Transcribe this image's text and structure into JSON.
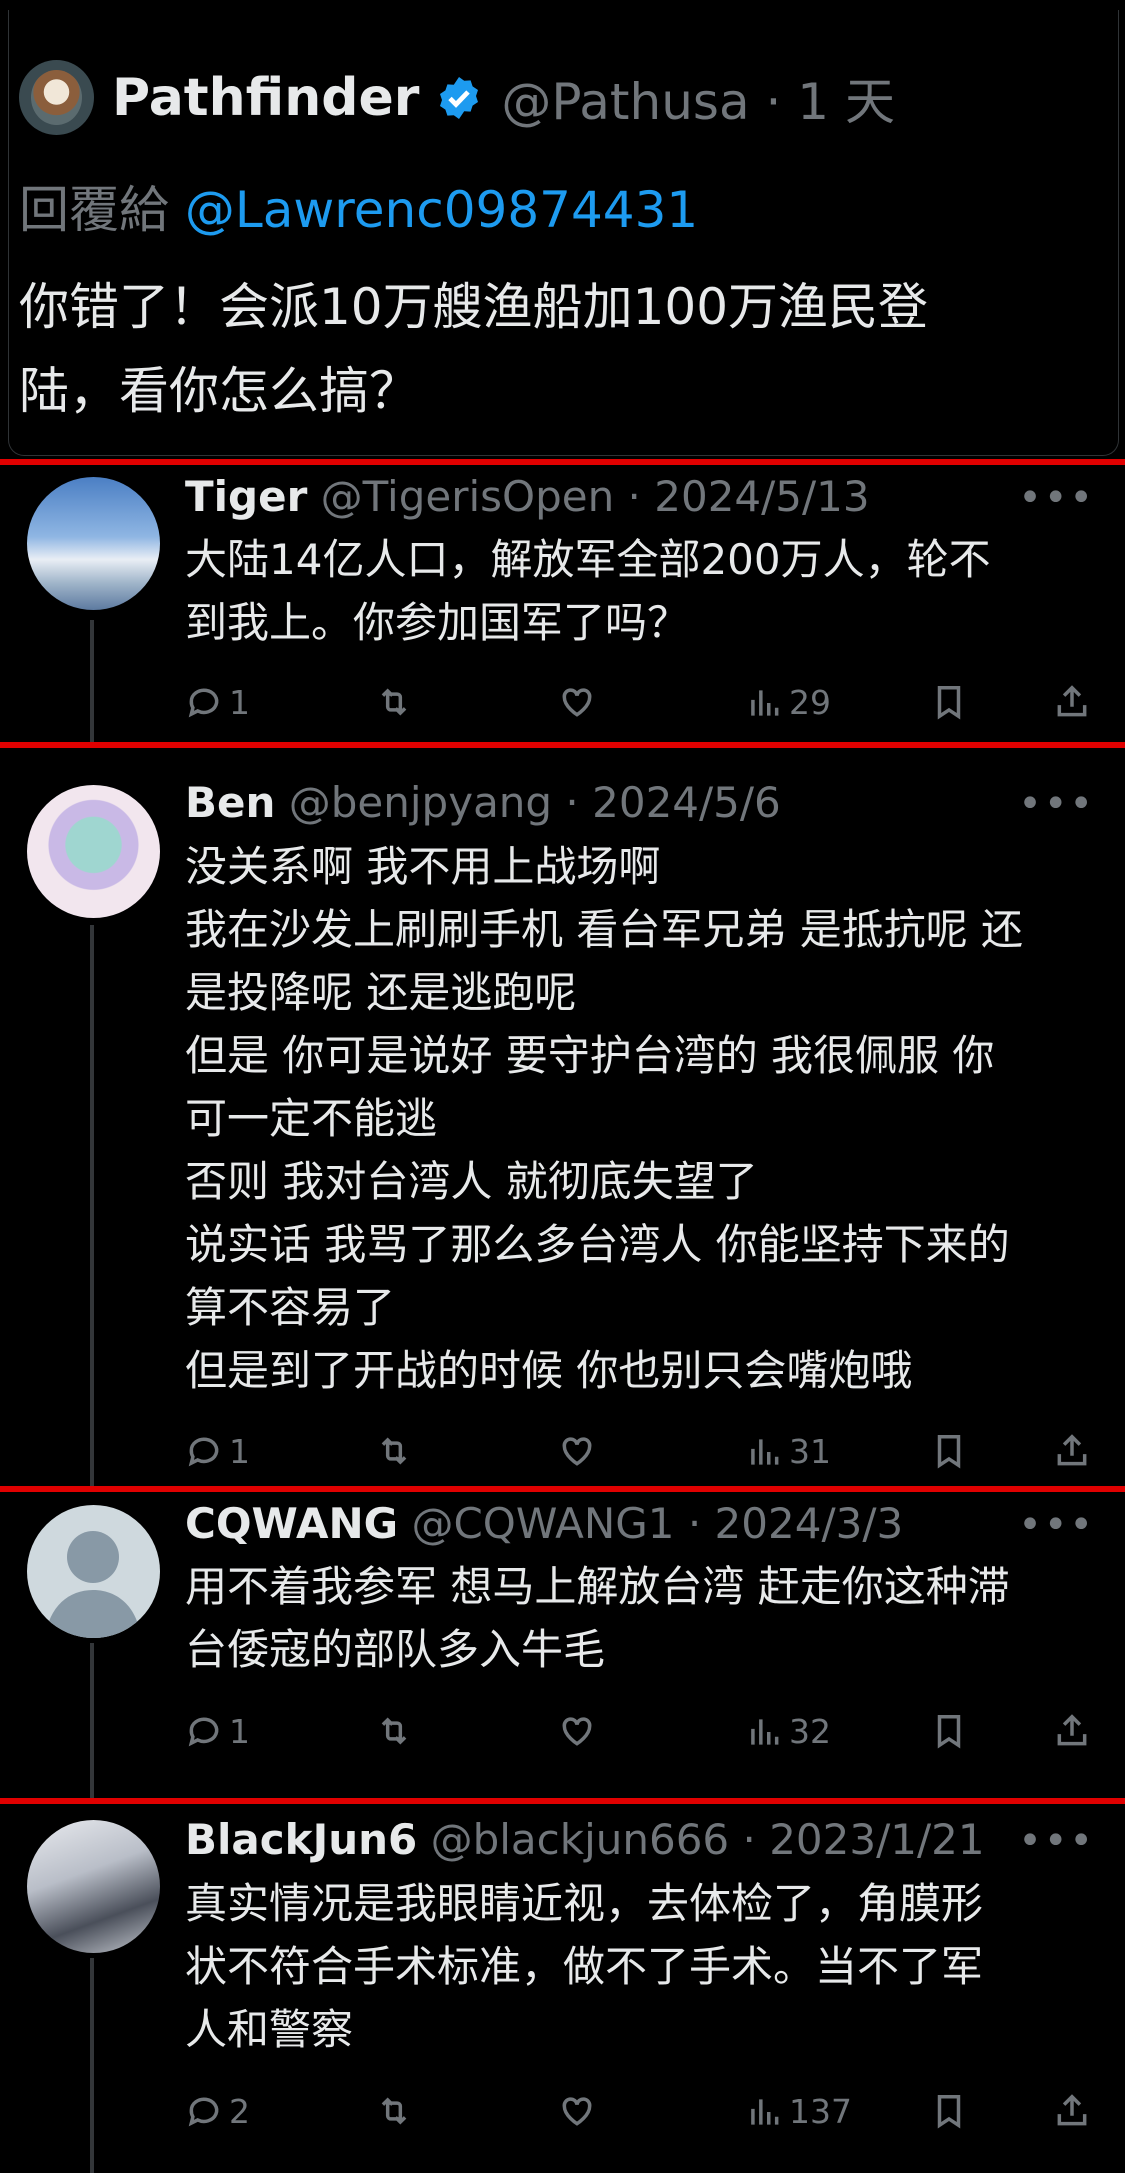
{
  "main_tweet": {
    "display_name": "Pathfinder",
    "handle_time": "@Pathusa · 1 天",
    "reply_prefix": "回覆給",
    "reply_mention": "@Lawrenc09874431",
    "text_line1": "你错了！会派10万艘渔船加100万渔民登",
    "text_line2": "陆，看你怎么搞？"
  },
  "replies": [
    {
      "name": "Tiger",
      "meta": "@TigerisOpen · 2024/5/13",
      "lines": [
        "大陆14亿人口，解放军全部200万人，轮不",
        "到我上。你参加国军了吗？"
      ],
      "replies": "1",
      "views": "29"
    },
    {
      "name": "Ben",
      "meta": "@benjpyang · 2024/5/6",
      "lines": [
        "没关系啊 我不用上战场啊",
        "我在沙发上刷刷手机 看台军兄弟 是抵抗呢 还",
        "是投降呢 还是逃跑呢",
        "但是 你可是说好 要守护台湾的 我很佩服 你",
        "可一定不能逃",
        "否则 我对台湾人 就彻底失望了",
        "说实话 我骂了那么多台湾人 你能坚持下来的",
        "算不容易了",
        "但是到了开战的时候 你也别只会嘴炮哦"
      ],
      "replies": "1",
      "views": "31"
    },
    {
      "name": "CQWANG",
      "meta": "@CQWANG1 · 2024/3/3",
      "lines": [
        "用不着我参军 想马上解放台湾 赶走你这种滞",
        "台倭寇的部队多入牛毛"
      ],
      "replies": "1",
      "views": "32"
    },
    {
      "name": "BlackJun6",
      "meta": "@blackjun666 · 2023/1/21",
      "lines": [
        "真实情况是我眼睛近视，去体检了，角膜形",
        "状不符合手术标准，做不了手术。当不了军",
        "人和警察"
      ],
      "replies": "2",
      "views": "137"
    }
  ],
  "more_label": "•••",
  "colors": {
    "accent": "#1d9bf0",
    "highlight_line": "#e00000",
    "muted": "#71767b"
  }
}
